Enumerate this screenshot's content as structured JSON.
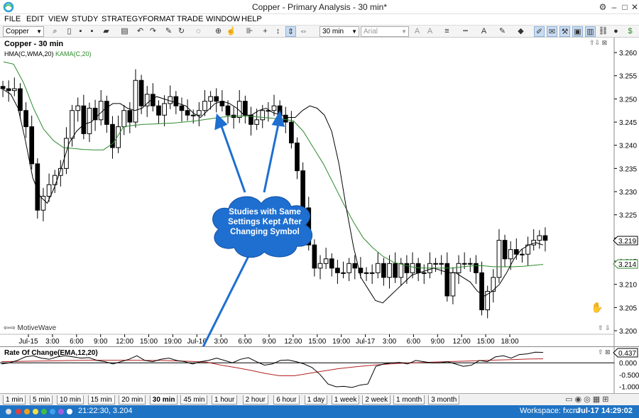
{
  "window": {
    "title": "Copper - Primary Analysis - 30 min*"
  },
  "menu": [
    "FILE",
    "EDIT",
    "VIEW",
    "STUDY",
    "STRATEGY",
    "FORMAT",
    "TRADE",
    "WINDOW",
    "HELP"
  ],
  "toolbar": {
    "symbol": "Copper",
    "interval": "30 min",
    "font": "Arial"
  },
  "main_pane": {
    "title": "Copper - 30 min",
    "studies": [
      "HMA(C,WMA,20)",
      "KAMA(C,20)"
    ],
    "brand": "MotiveWave",
    "price_axis": [
      "3.260",
      "3.255",
      "3.250",
      "3.245",
      "3.240",
      "3.235",
      "3.230",
      "3.225",
      "3.220",
      "3.215",
      "3.210",
      "3.205",
      "3.200"
    ],
    "price_badges": [
      "3.219",
      "3.214"
    ],
    "time_axis": [
      "Jul-15",
      "3:00",
      "6:00",
      "9:00",
      "12:00",
      "15:00",
      "19:00",
      "Jul-16",
      "3:00",
      "6:00",
      "9:00",
      "12:00",
      "15:00",
      "19:00",
      "Jul-17",
      "3:00",
      "6:00",
      "9:00",
      "12:00",
      "15:00",
      "18:00"
    ],
    "callout": [
      "Studies with Same",
      "Settings Kept After",
      "Changing Symbol"
    ]
  },
  "roc_pane": {
    "title": "Rate Of Change(EMA,12,20)",
    "axis": [
      "0.000",
      "-0.500",
      "-1.000"
    ],
    "badge": "0.437"
  },
  "timeframes": [
    "1 min",
    "5 min",
    "10 min",
    "15 min",
    "20 min",
    "30 min",
    "45 min",
    "1 hour",
    "2 hour",
    "6 hour",
    "1 day",
    "1 week",
    "2 week",
    "1 month",
    "3 month"
  ],
  "active_timeframe": "30 min",
  "status": {
    "cursor": "21:22:30, 3.204",
    "workspace": "Workspace: fxcm",
    "clock": "Jul-17 14:29:02"
  },
  "colors": {
    "hma": "#000000",
    "kama": "#2e8b2e",
    "roc_signal": "#b22222",
    "callout": "#1e6fd0",
    "status": "#1f73c4"
  },
  "chart_data": {
    "type": "candlestick",
    "y_range": [
      3.2,
      3.262
    ],
    "close": [
      3.2522,
      3.2518,
      3.2522,
      3.2475,
      3.244,
      3.236,
      3.226,
      3.229,
      3.2315,
      3.2335,
      3.235,
      3.2415,
      3.2475,
      3.2485,
      3.2425,
      3.248,
      3.2455,
      3.2495,
      3.2445,
      3.2395,
      3.244,
      3.2475,
      3.245,
      3.254,
      3.2485,
      3.251,
      3.2485,
      3.2465,
      3.249,
      3.2505,
      3.2485,
      3.2475,
      3.2465,
      3.2465,
      3.2475,
      3.2495,
      3.2505,
      3.2495,
      3.2485,
      3.2465,
      3.246,
      3.2495,
      3.2465,
      3.2445,
      3.2455,
      3.2475,
      3.2475,
      3.2485,
      3.2465,
      3.245,
      3.2405,
      3.2345,
      3.2265,
      3.2185,
      3.2135,
      3.2145,
      3.2155,
      3.2135,
      3.2125,
      3.2125,
      3.2145,
      3.2135,
      3.2125,
      3.2125,
      3.2125,
      3.2145,
      3.2115,
      3.2145,
      3.2115,
      3.2145,
      3.2125,
      3.2145,
      3.2125,
      3.2125,
      3.2145,
      3.2145,
      3.2145,
      3.2075,
      3.2125,
      3.2145,
      3.2145,
      3.2145,
      3.2125,
      3.2045,
      3.2085,
      3.2115,
      3.2195,
      3.2155,
      3.2175,
      3.2165,
      3.2165,
      3.2185,
      3.2195,
      3.2205,
      3.2195
    ],
    "hma": [
      3.252,
      3.251,
      3.248,
      3.241,
      3.233,
      3.229,
      3.2275,
      3.231,
      3.2355,
      3.2405,
      3.243,
      3.2445,
      3.245,
      3.2465,
      3.248,
      3.249,
      3.249,
      3.248,
      3.2475,
      3.248,
      3.2495,
      3.2505,
      3.25,
      3.2495,
      3.249,
      3.2485,
      3.247,
      3.246,
      3.2475,
      3.249,
      3.2495,
      3.249,
      3.248,
      3.2465,
      3.2465,
      3.2475,
      3.248,
      3.247,
      3.2465,
      3.246,
      3.246,
      3.2475,
      3.2485,
      3.248,
      3.2465,
      3.243,
      3.236,
      3.2265,
      3.218,
      3.2115,
      3.209,
      3.2065,
      3.206,
      3.2075,
      3.209,
      3.2105,
      3.212,
      3.2125,
      3.213,
      3.2135,
      3.213,
      3.2125,
      3.2125,
      3.2115,
      3.2105,
      3.2085,
      3.2075,
      3.2085,
      3.21,
      3.2125,
      3.2155,
      3.2175,
      3.2185,
      3.219,
      3.2185
    ],
    "kama": [
      3.258,
      3.2575,
      3.2535,
      3.248,
      3.2435,
      3.241,
      3.2395,
      3.2393,
      3.2391,
      3.239,
      3.239,
      3.2405,
      3.244,
      3.2443,
      3.2445,
      3.2446,
      3.2447,
      3.2448,
      3.245,
      3.2452,
      3.2455,
      3.2458,
      3.2461,
      3.2463,
      3.2463,
      3.2462,
      3.246,
      3.2458,
      3.2456,
      3.2453,
      3.243,
      3.2395,
      3.236,
      3.2318,
      3.2275,
      3.2235,
      3.22,
      3.2178,
      3.216,
      3.2148,
      3.2142,
      3.2137,
      3.2135,
      3.2135,
      3.2135,
      3.2135,
      3.2138,
      3.214,
      3.214,
      3.2138,
      3.2138,
      3.2138,
      3.2139,
      3.2141,
      3.2143
    ],
    "roc": [
      -0.05,
      0.0,
      0.1,
      0.25,
      0.3,
      0.2,
      0.15,
      0.25,
      0.3,
      0.25,
      0.2,
      0.22,
      0.1,
      0.05,
      -0.05,
      0.05,
      0.15,
      0.3,
      0.1,
      0.05,
      0.15,
      0.2,
      0.1,
      0.05,
      -0.05,
      0.05,
      0.1,
      0.2,
      0.1,
      0.0,
      0.15,
      0.22,
      0.05,
      -0.1,
      -0.05,
      0.1,
      0.12,
      0.05,
      -0.05,
      -0.2,
      -0.5,
      -0.9,
      -1.02,
      -1.0,
      -1.05,
      -0.95,
      -0.9,
      -0.15,
      -0.05,
      0.0,
      0.02,
      -0.05,
      0.1,
      0.05,
      0.0,
      0.0,
      0.05,
      -0.05,
      -0.15,
      -0.1,
      0.1,
      0.05,
      0.25,
      0.3,
      0.2,
      0.35,
      0.38,
      0.45,
      0.44
    ],
    "roc_signal": [
      0.05,
      0.06,
      0.07,
      0.08,
      0.09,
      0.1,
      0.11,
      0.11,
      0.11,
      0.11,
      0.1,
      0.1,
      0.08,
      0.06,
      0.03,
      -0.1,
      -0.2,
      -0.32,
      -0.45,
      -0.55,
      -0.55,
      -0.45,
      -0.35,
      -0.25,
      -0.18,
      -0.12,
      -0.07,
      -0.03,
      0.0,
      0.02,
      0.04,
      0.06,
      0.08,
      0.1,
      0.12,
      0.14,
      0.16,
      0.17
    ],
    "roc_range": [
      -1.2,
      0.55
    ]
  }
}
